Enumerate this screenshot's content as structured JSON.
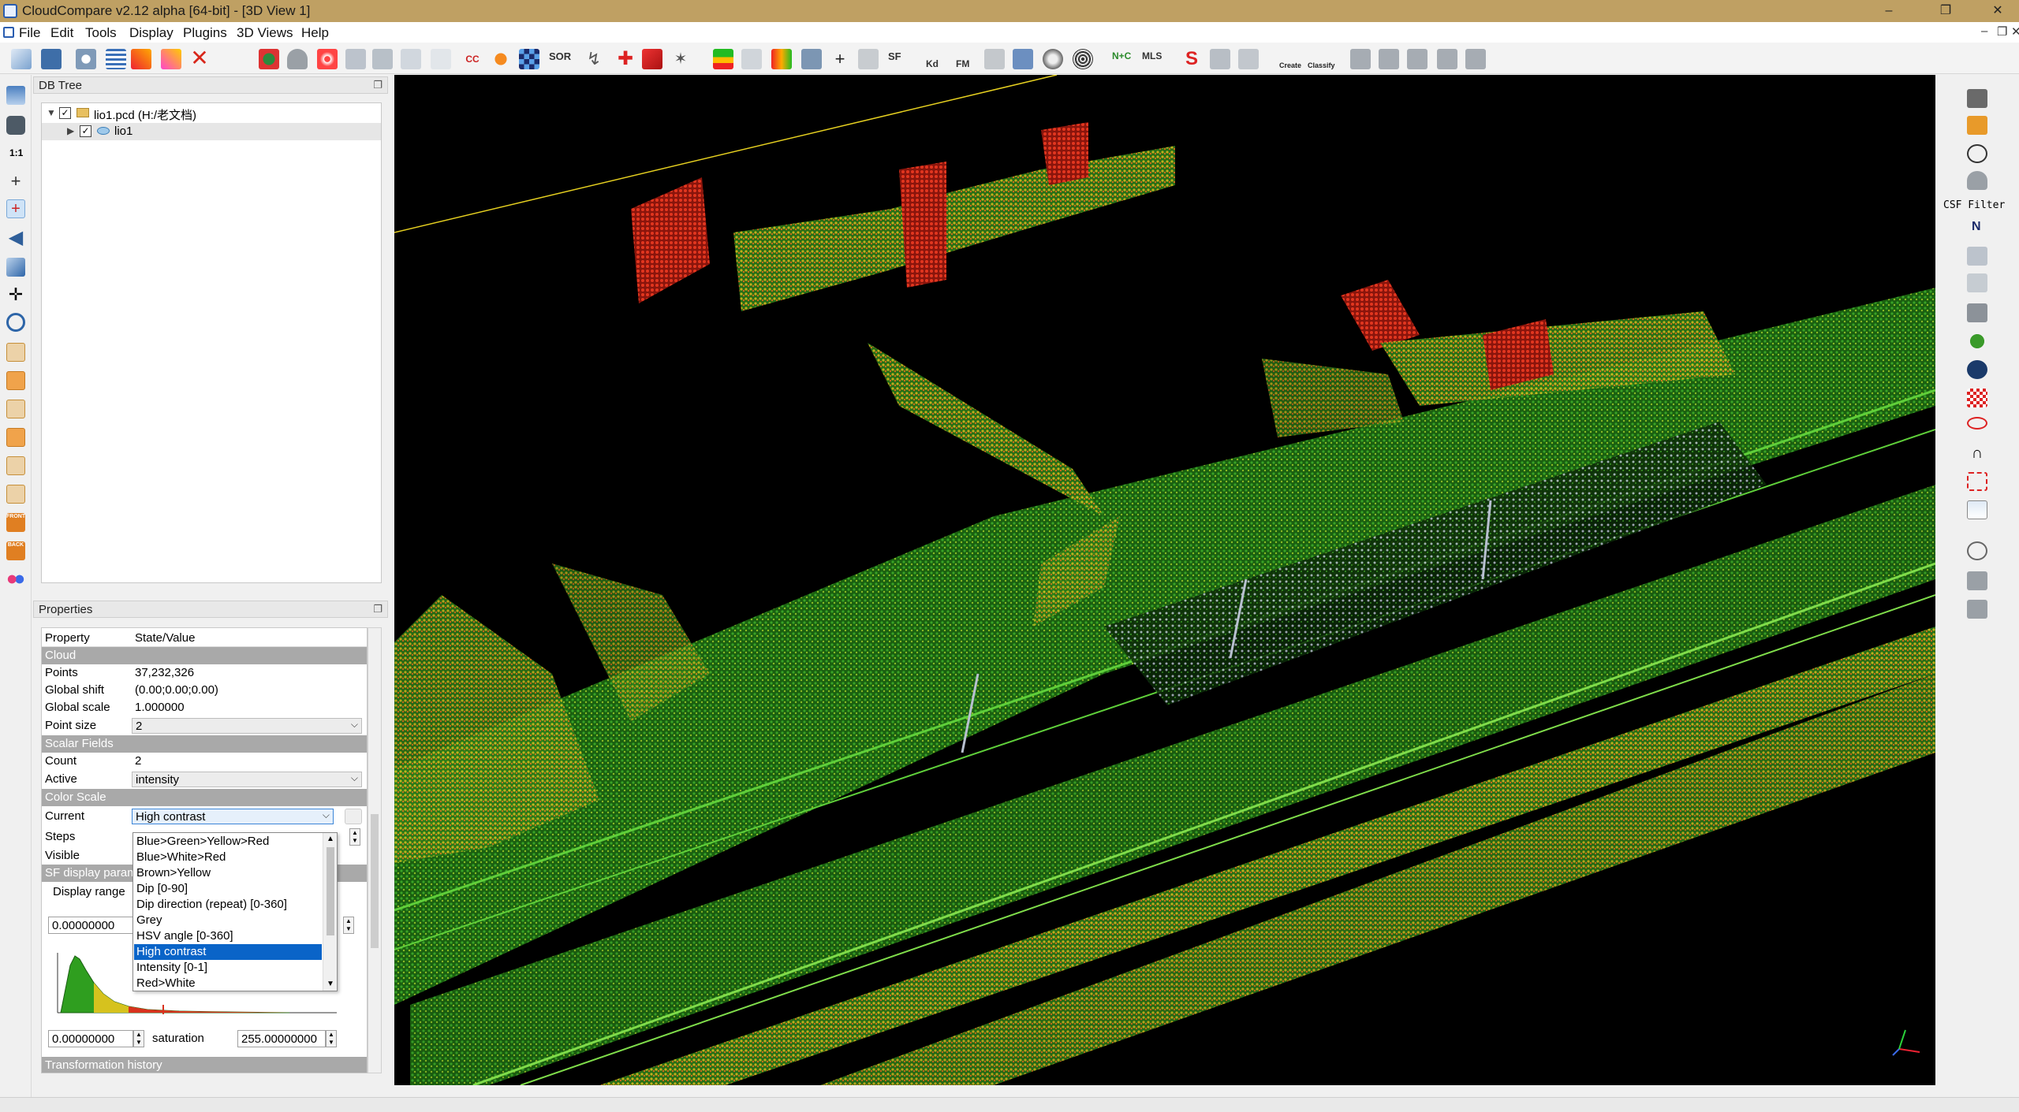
{
  "window": {
    "title": "CloudCompare v2.12 alpha [64-bit] - [3D View 1]",
    "minimize": "–",
    "maximize": "❐",
    "close": "✕"
  },
  "menu": [
    "File",
    "Edit",
    "Tools",
    "Display",
    "Plugins",
    "3D Views",
    "Help"
  ],
  "toolbar_labels": {
    "sor": "SOR",
    "sf": "SF",
    "kd": "Kd",
    "fm": "FM",
    "nc": "N+C",
    "mls": "MLS",
    "csf": "CSF Filter",
    "scale_1_1": "1:1",
    "canupo_create": "Create",
    "canupo_classify": "Classify",
    "front": "FRONT",
    "back": "BACK",
    "north": "N"
  },
  "dbtree": {
    "title": "DB Tree",
    "items": [
      {
        "label": "lio1.pcd (H:/老文档)",
        "checked": "✓"
      },
      {
        "label": "lio1",
        "checked": "✓"
      }
    ]
  },
  "properties": {
    "title": "Properties",
    "header": {
      "property": "Property",
      "value": "State/Value"
    },
    "cloud_section": "Cloud",
    "points": {
      "k": "Points",
      "v": "37,232,326"
    },
    "global_shift": {
      "k": "Global shift",
      "v": "(0.00;0.00;0.00)"
    },
    "global_scale": {
      "k": "Global scale",
      "v": "1.000000"
    },
    "point_size": {
      "k": "Point size",
      "v": "2"
    },
    "scalar_section": "Scalar Fields",
    "count": {
      "k": "Count",
      "v": "2"
    },
    "active": {
      "k": "Active",
      "v": "intensity"
    },
    "color_section": "Color Scale",
    "current": {
      "k": "Current",
      "v": "High contrast"
    },
    "steps": {
      "k": "Steps"
    },
    "visible": {
      "k": "Visible"
    },
    "sf_display_section": "SF display param",
    "display_range": "Display range",
    "range_min": "0.00000000",
    "sat_min": "0.00000000",
    "saturation_label": "saturation",
    "sat_max": "255.00000000",
    "transformation_history": "Transformation history"
  },
  "color_scale_options": [
    "Blue>Green>Yellow>Red",
    "Blue>White>Red",
    "Brown>Yellow",
    "Dip [0-90]",
    "Dip direction (repeat) [0-360]",
    "Grey",
    "HSV angle [0-360]",
    "High contrast",
    "Intensity [0-1]",
    "Red>White"
  ],
  "selected_option": "High contrast",
  "colors": {
    "titlebar": "#bfa063",
    "selection": "#0a64c8",
    "section": "#a9a9a9",
    "cloud_green": "#2f9e1f",
    "cloud_red": "#d8321e",
    "cloud_yellow": "#d6c21e",
    "cloud_grey": "#b8c0d0"
  }
}
